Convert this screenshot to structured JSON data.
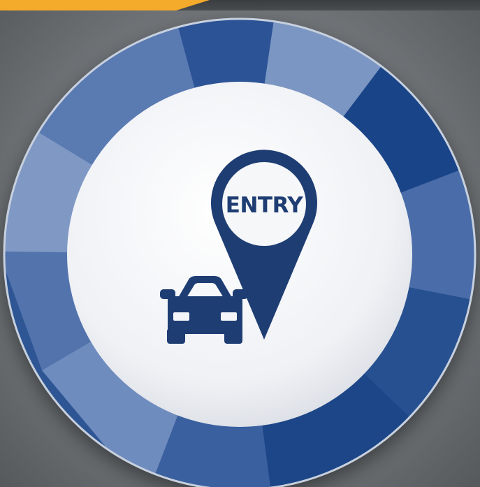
{
  "icon": {
    "label": "ENTRY",
    "pin": "map-pin-icon",
    "vehicle": "car-icon"
  },
  "colors": {
    "accent": "#f4aa2a",
    "ring_dark": "#1d4583",
    "ring_mid": "#3d62a0",
    "ring_light": "#6f8dbd",
    "icon": "#1e3d73",
    "disc": "#f2f3f6"
  }
}
